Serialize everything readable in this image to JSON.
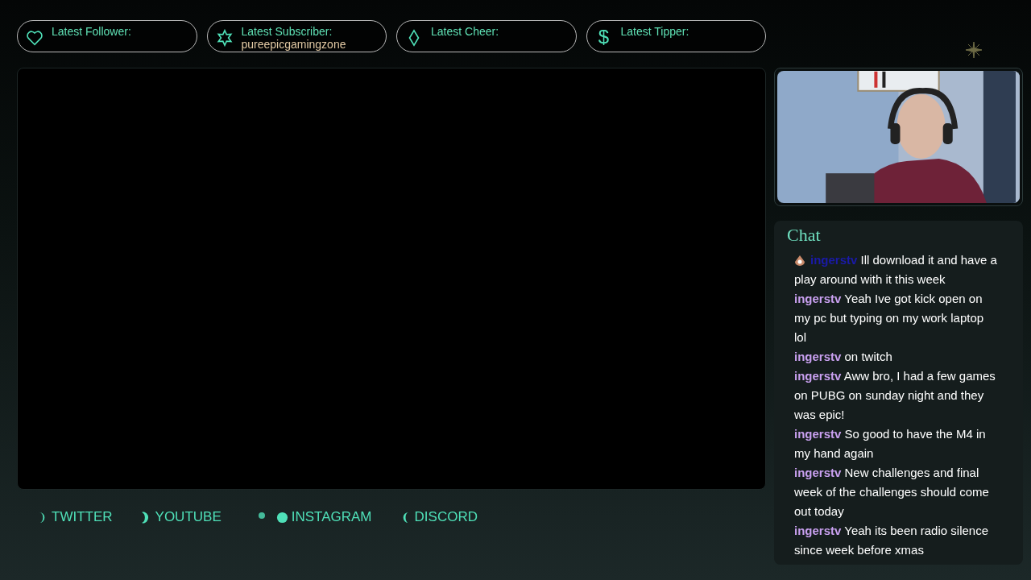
{
  "alerts": [
    {
      "kind": "heart",
      "label": "Latest Follower:"
    },
    {
      "kind": "star",
      "label": "Latest Subscriber:",
      "value": "pureepicgamingzone"
    },
    {
      "kind": "diamond",
      "label": "Latest Cheer:"
    },
    {
      "kind": "dollar",
      "symbol": "$",
      "label": "Latest Tipper:"
    }
  ],
  "chat": {
    "title": "Chat",
    "messages": [
      {
        "user": "ingerstv",
        "color": "#1a1aa8",
        "badge": true,
        "text": "Ill download it and have a play around with it this week"
      },
      {
        "user": "ingerstv",
        "color": "#c9a0f0",
        "badge": false,
        "text": "Yeah Ive got kick open on my pc but typing on my work laptop lol"
      },
      {
        "user": "ingerstv",
        "color": "#c9a0f0",
        "badge": false,
        "text": "on twitch"
      },
      {
        "user": "ingerstv",
        "color": "#c9a0f0",
        "badge": false,
        "text": "Aww bro, I had a few games on PUBG on sunday night and they was epic!"
      },
      {
        "user": "ingerstv",
        "color": "#c9a0f0",
        "badge": false,
        "text": "So good to have the M4 in my hand again"
      },
      {
        "user": "ingerstv",
        "color": "#c9a0f0",
        "badge": false,
        "text": "New challenges and final week of the challenges should come out today"
      },
      {
        "user": "ingerstv",
        "color": "#c9a0f0",
        "badge": false,
        "text": "Yeah its been radio silence since week before xmas"
      }
    ]
  },
  "socials": [
    {
      "kind": "crescent-right",
      "label": "TWITTER"
    },
    {
      "kind": "gibbous-right",
      "label": "YOUTUBE"
    },
    {
      "kind": "full",
      "label": "INSTAGRAM"
    },
    {
      "kind": "crescent-left",
      "label": "DISCORD"
    }
  ]
}
